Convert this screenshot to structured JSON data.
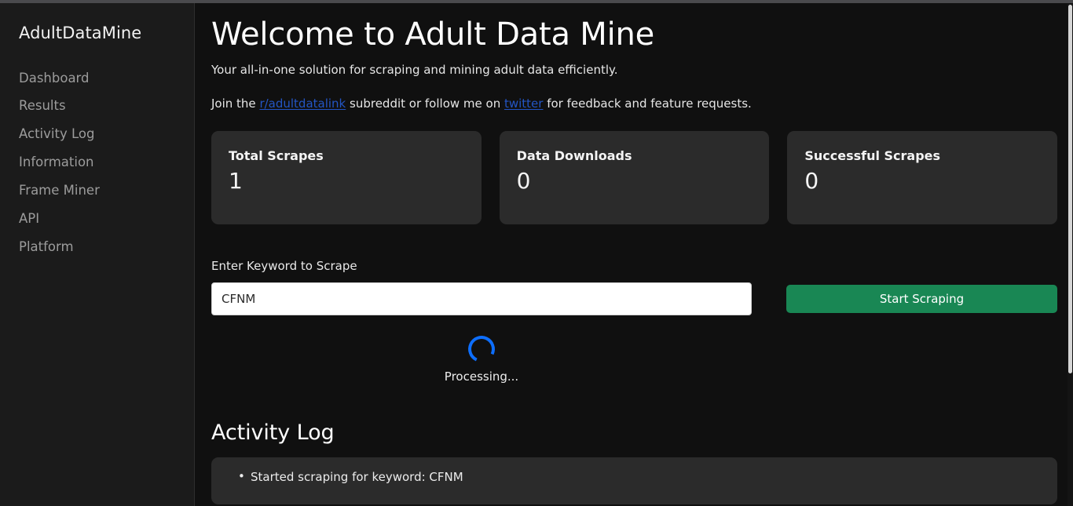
{
  "sidebar": {
    "brand": "AdultDataMine",
    "items": [
      {
        "label": "Dashboard"
      },
      {
        "label": "Results"
      },
      {
        "label": "Activity Log"
      },
      {
        "label": "Information"
      },
      {
        "label": "Frame Miner"
      },
      {
        "label": "API"
      },
      {
        "label": "Platform"
      }
    ]
  },
  "main": {
    "title": "Welcome to Adult Data Mine",
    "subtitle": "Your all-in-one solution for scraping and mining adult data efficiently.",
    "join": {
      "prefix": "Join the ",
      "subreddit_link": "r/adultdatalink",
      "middle": " subreddit or follow me on ",
      "twitter_link": "twitter",
      "suffix": " for feedback and feature requests."
    },
    "stats": [
      {
        "label": "Total Scrapes",
        "value": "1"
      },
      {
        "label": "Data Downloads",
        "value": "0"
      },
      {
        "label": "Successful Scrapes",
        "value": "0"
      }
    ],
    "form": {
      "keyword_label": "Enter Keyword to Scrape",
      "keyword_value": "CFNM",
      "keyword_placeholder": "Enter Keyword to Scrape",
      "start_button": "Start Scraping"
    },
    "status": {
      "spinner_text": "Processing...",
      "spinner_color": "#0d6efd"
    },
    "activity": {
      "title": "Activity Log",
      "entries": [
        "Started scraping for keyword: CFNM"
      ]
    }
  },
  "colors": {
    "accent_green": "#198754",
    "link_blue": "#2355c4",
    "sidebar_bg": "#1b1b1b",
    "main_bg": "#101010",
    "card_bg": "#2b2b2b"
  }
}
